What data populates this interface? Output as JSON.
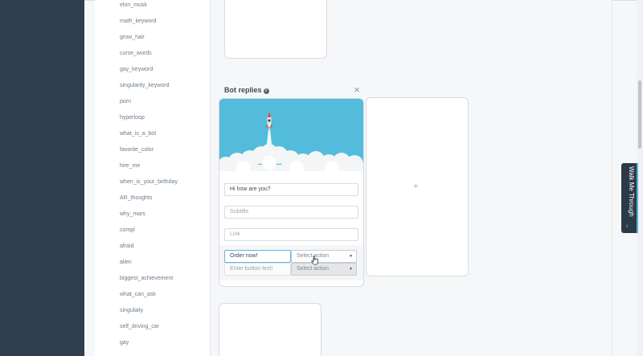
{
  "sidebar": {
    "intents": [
      "elon_musk",
      "math_keyword",
      "grow_hair",
      "curse_words",
      "gay_keyword",
      "singularity_keyword",
      "porn",
      "hyperloop",
      "what_is_a_bot",
      "favorite_color",
      "hire_me",
      "when_is_your_birthday",
      "AR_thoughts",
      "why_mars",
      "compl",
      "afraid",
      "alien",
      "biggest_achievement",
      "what_can_ask",
      "singulaity",
      "self_driving_car",
      "gay"
    ]
  },
  "panel": {
    "title": "Bot replies",
    "info_icon": "info-icon",
    "close_icon": "close-icon"
  },
  "reply_card": {
    "hero_icon": "rocket-launch-illustration",
    "hero_bg_color": "#53bcdc",
    "title_value": "Hi how are you?",
    "subtitle_placeholder": "Subtitle",
    "link_placeholder": "Link",
    "buttons": [
      {
        "text": "Order now!",
        "action": "Select action"
      },
      {
        "text": "Enter button text!",
        "action": "Select action"
      }
    ]
  },
  "add_card": {
    "icon": "plus-icon",
    "label": "+"
  },
  "walkthrough": {
    "label": "Walk Me Through",
    "icon": "chevron-left-icon",
    "chevron": "‹",
    "accent": "#4fb5e0"
  }
}
